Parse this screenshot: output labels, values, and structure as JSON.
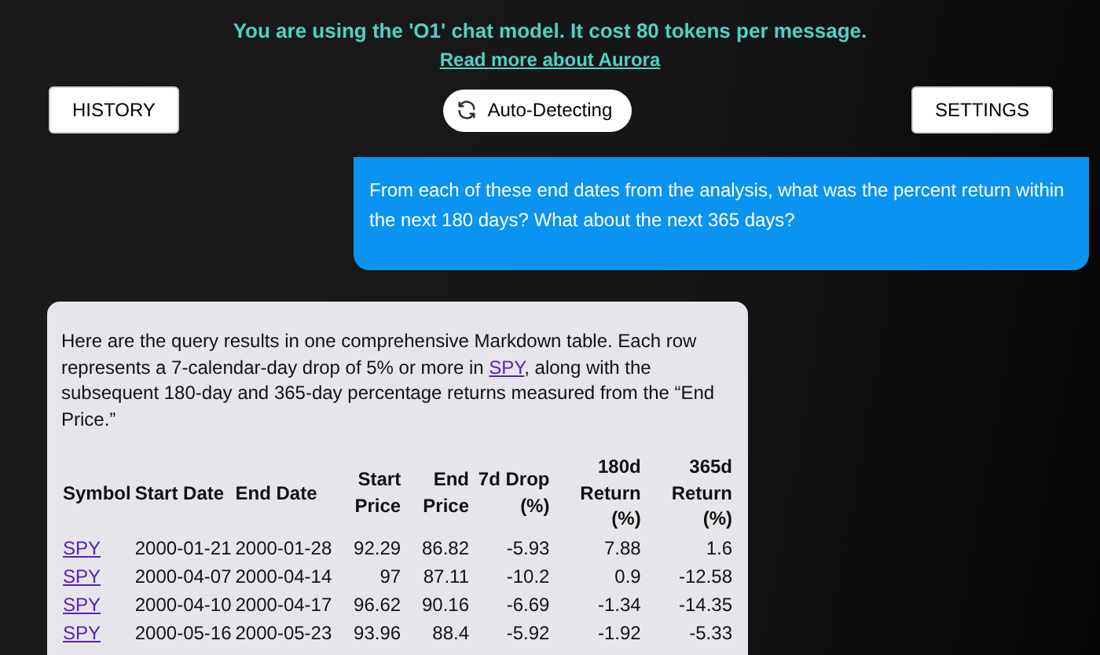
{
  "banner": {
    "notice": "You are using the 'O1' chat model. It cost 80 tokens per message.",
    "link": "Read more about Aurora"
  },
  "toolbar": {
    "history_button": "HISTORY",
    "mode_button": "Auto-Detecting",
    "settings_button": "SETTINGS"
  },
  "messages": [
    {
      "kind": "user",
      "text": "From each of these end dates from the analysis, what was the percent return within the next 180 days? What about the next 365 days?"
    },
    {
      "kind": "assistant",
      "intro_before": "Here are the query results in one comprehensive Markdown table. Each row represents a 7-calendar-day drop of 5% or more in",
      "intro_link": "SPY",
      "intro_after": ", along with the subsequent 180-day and 365-day percentage returns measured from the “End Price.”",
      "table": {
        "columns": [
          "Symbol",
          "Start Date",
          "End Date",
          "Start Price",
          "End Price",
          "7d Drop (%)",
          "180d Return (%)",
          "365d Return (%)"
        ],
        "rows": [
          [
            "SPY",
            "2000-01-21",
            "2000-01-28",
            "92.29",
            "86.82",
            "-5.93",
            "7.88",
            "1.6"
          ],
          [
            "SPY",
            "2000-04-07",
            "2000-04-14",
            "97",
            "87.11",
            "-10.2",
            "0.9",
            "-12.58"
          ],
          [
            "SPY",
            "2000-04-10",
            "2000-04-17",
            "96.62",
            "90.16",
            "-6.69",
            "-1.34",
            "-14.35"
          ],
          [
            "SPY",
            "2000-05-16",
            "2000-05-23",
            "93.96",
            "88.4",
            "-5.92",
            "-1.92",
            "-5.33"
          ]
        ]
      }
    }
  ]
}
